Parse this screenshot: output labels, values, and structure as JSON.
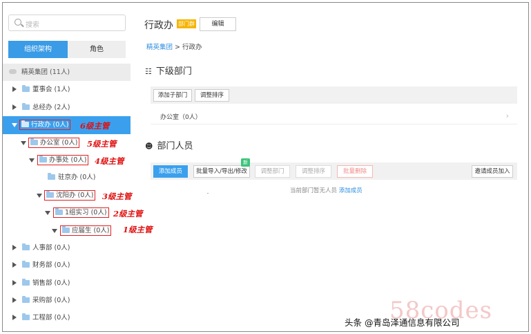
{
  "search": {
    "placeholder": "搜索"
  },
  "left_tabs": [
    {
      "label": "组织架构",
      "active": true
    },
    {
      "label": "角色",
      "active": false
    }
  ],
  "tree": [
    {
      "label": "精英集团 (11人)",
      "level": 0,
      "expander": "none",
      "root": true
    },
    {
      "label": "董事会 (1人)",
      "level": 1,
      "expander": "collapsed"
    },
    {
      "label": "总经办 (2人)",
      "level": 1,
      "expander": "collapsed"
    },
    {
      "label": "行政办 (0人)",
      "level": 1,
      "expander": "expanded",
      "selected": true,
      "boxed": true
    },
    {
      "label": "办公室 (0人)",
      "level": 2,
      "expander": "expanded",
      "boxed": true
    },
    {
      "label": "办事处 (0人)",
      "level": 3,
      "expander": "expanded",
      "boxed": true
    },
    {
      "label": "驻京办 (0人)",
      "level": 4,
      "expander": "none"
    },
    {
      "label": "沈阳办 (0人)",
      "level": 4,
      "expander": "expanded",
      "boxed": true
    },
    {
      "label": "1组实习 (0人)",
      "level": 5,
      "expander": "expanded",
      "boxed": true
    },
    {
      "label": "应届生 (0人)",
      "level": 6,
      "expander": "expanded",
      "boxed": true
    },
    {
      "label": "人事部 (0人)",
      "level": 1,
      "expander": "collapsed"
    },
    {
      "label": "财务部 (0人)",
      "level": 1,
      "expander": "collapsed"
    },
    {
      "label": "销售部 (0人)",
      "level": 1,
      "expander": "collapsed"
    },
    {
      "label": "采购部 (0人)",
      "level": 1,
      "expander": "collapsed"
    },
    {
      "label": "工程部 (0人)",
      "level": 1,
      "expander": "collapsed"
    }
  ],
  "annotations": [
    "6级主管",
    "5级主管",
    "4级主管",
    "3级主管",
    "2级主管",
    "1级主管"
  ],
  "dept": {
    "title": "行政办",
    "badge": "部门群",
    "edit_label": "编辑",
    "breadcrumb": {
      "parent": "精英集团",
      "separator": ">",
      "current": "行政办"
    }
  },
  "subdepts": {
    "heading": "下级部门",
    "buttons": [
      "添加子部门",
      "调整排序"
    ],
    "rows": [
      {
        "name": "办公室（0人）"
      }
    ]
  },
  "members": {
    "heading": "部门人员",
    "buttons": {
      "add": "添加成员",
      "batch": "批量导入/导出/修改",
      "adjust_dept": "调整部门",
      "adjust_order": "调整排序",
      "batch_delete": "批量删除",
      "invite": "邀请成员加入"
    },
    "new_tag": "新",
    "empty_text": "当前部门暂无人员",
    "empty_link": "添加成员"
  },
  "watermark": "58codes",
  "credit": "头条 @青岛泽通信息有限公司",
  "colors": {
    "accent": "#3aa0ee",
    "selected_row": "#3aa0ee",
    "annotation": "#e01010",
    "badge": "#f5b400",
    "new_tag": "#3dc47a"
  }
}
